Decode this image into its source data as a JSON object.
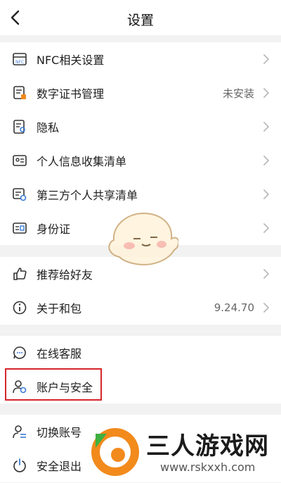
{
  "header": {
    "title": "设置",
    "back_icon": "back-chevron-icon"
  },
  "groups": [
    {
      "items": [
        {
          "icon": "nfc-icon",
          "label": "NFC相关设置",
          "value": ""
        },
        {
          "icon": "certificate-icon",
          "label": "数字证书管理",
          "value": "未安装"
        },
        {
          "icon": "privacy-icon",
          "label": "隐私",
          "value": ""
        },
        {
          "icon": "id-card-icon",
          "label": "个人信息收集清单",
          "value": ""
        },
        {
          "icon": "share-list-icon",
          "label": "第三方个人共享清单",
          "value": ""
        },
        {
          "icon": "identity-icon",
          "label": "身份证",
          "value": ""
        }
      ]
    },
    {
      "items": [
        {
          "icon": "thumbs-up-icon",
          "label": "推荐给好友",
          "value": ""
        },
        {
          "icon": "info-icon",
          "label": "关于和包",
          "value": "9.24.70"
        }
      ]
    },
    {
      "items": [
        {
          "icon": "customer-service-icon",
          "label": "在线客服",
          "value": ""
        },
        {
          "icon": "account-security-icon",
          "label": "账户与安全",
          "value": ""
        }
      ]
    },
    {
      "items": [
        {
          "icon": "switch-account-icon",
          "label": "切换账号",
          "value": ""
        },
        {
          "icon": "logout-icon",
          "label": "安全退出",
          "value": ""
        }
      ]
    }
  ],
  "watermark": {
    "name": "三人游戏网",
    "url": "www.rskxxh.com"
  },
  "colors": {
    "highlight": "#d6262c",
    "accent": "#f28a1c",
    "icon": "#333333"
  }
}
